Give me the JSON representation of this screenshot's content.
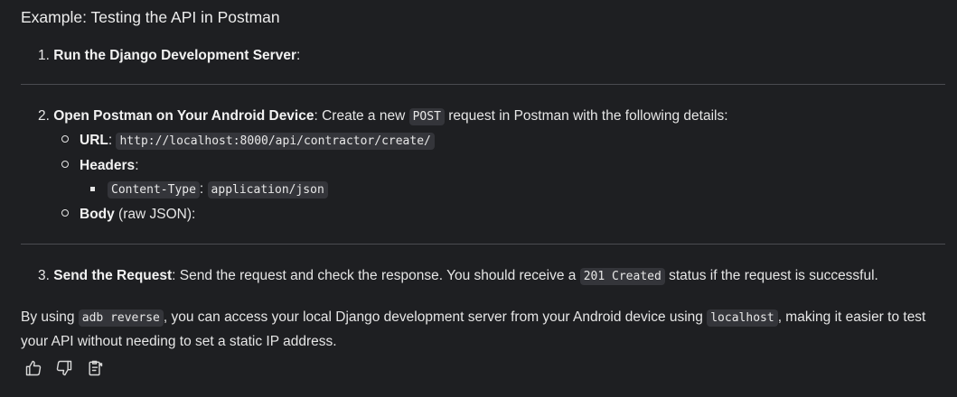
{
  "heading": "Example: Testing the API in Postman",
  "steps": {
    "s1": {
      "num": "1.",
      "title": "Run the Django Development Server",
      "tail": ":"
    },
    "s2": {
      "num": "2.",
      "title": "Open Postman on Your Android Device",
      "text1": ": Create a new ",
      "code1": "POST",
      "text2": " request in Postman with the following details:",
      "url_label": "URL",
      "url_sep": ": ",
      "url_code": "http://localhost:8000/api/contractor/create/",
      "headers_label": "Headers",
      "headers_sep": ":",
      "header_key": "Content-Type",
      "header_sep": ": ",
      "header_value": "application/json",
      "body_label": "Body",
      "body_text": " (raw JSON):"
    },
    "s3": {
      "num": "3.",
      "title": "Send the Request",
      "text1": ": Send the request and check the response. You should receive a ",
      "code1": "201 Created",
      "text2": " status if the request is successful."
    }
  },
  "paragraph": {
    "t1": "By using ",
    "c1": "adb reverse",
    "t2": ", you can access your local Django development server from your Android device using ",
    "c2": "localhost",
    "t3": ", making it easier to test your API without needing to set a static IP address."
  },
  "actions": {
    "icons": [
      "thumbs-up-icon",
      "thumbs-down-icon",
      "copy-icon"
    ]
  },
  "colors": {
    "background": "#1e1f22",
    "text": "#e6e6e6",
    "code_bg": "#34353a",
    "divider": "#4a4b50"
  }
}
